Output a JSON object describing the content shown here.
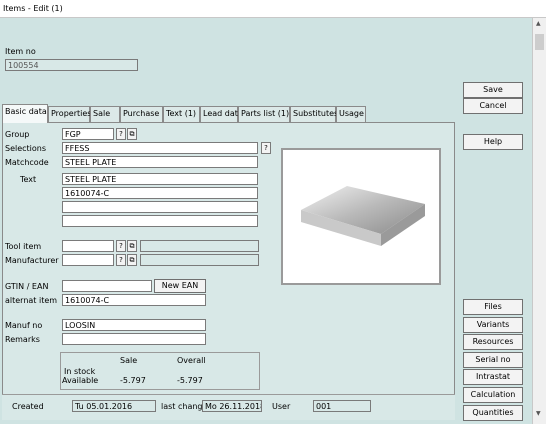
{
  "window": {
    "title": "Items - Edit (1)"
  },
  "header": {
    "item_no_label": "Item no",
    "item_no_value": "100554"
  },
  "actions": {
    "save": "Save",
    "cancel": "Cancel",
    "help": "Help"
  },
  "tabs": [
    {
      "label": "Basic data",
      "active": true
    },
    {
      "label": "Properties"
    },
    {
      "label": "Sale"
    },
    {
      "label": "Purchase"
    },
    {
      "label": "Text (1)"
    },
    {
      "label": "Lead dat"
    },
    {
      "label": "Parts list (1)"
    },
    {
      "label": "Substitutes"
    },
    {
      "label": "Usage"
    }
  ],
  "basic": {
    "group_label": "Group",
    "group_value": "FGP",
    "selection_label": "Selections",
    "selection_value": "FFESS",
    "matchcode_label": "Matchcode",
    "matchcode_value": "STEEL PLATE",
    "text_label": "Text",
    "text_lines": [
      "STEEL PLATE",
      "1610074-C",
      "",
      ""
    ],
    "tool_label": "Tool item",
    "manufacturer_label": "Manufacturer",
    "gtin_label": "GTIN / EAN",
    "gtin_value": "",
    "new_ean_button": "New EAN",
    "alt_item_label": "alternat item",
    "alt_item_value": "1610074-C",
    "manuf_no_label": "Manuf no",
    "manuf_no_value": "LOOSIN",
    "remarks_label": "Remarks",
    "remarks_value": ""
  },
  "stock": {
    "col_sale": "Sale",
    "col_overall": "Overall",
    "instock_label": "In stock",
    "available_label": "Available",
    "available_sale": "-5.797",
    "available_overall": "-5.797"
  },
  "status": {
    "created_label": "Created",
    "created_value": "Tu 05.01.2016",
    "last_change_label": "last change",
    "last_change_value": "Mo 26.11.2018",
    "user_label": "User",
    "user_value": "001"
  },
  "side_buttons": [
    "Files",
    "Variants",
    "Resources",
    "Serial no",
    "Intrastat",
    "Calculation",
    "Quantities"
  ],
  "icons": {
    "product_image": "steel-plate-image"
  }
}
